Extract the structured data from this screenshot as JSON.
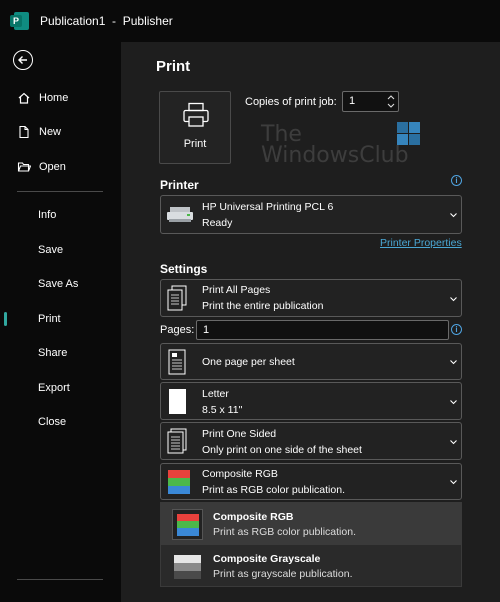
{
  "window": {
    "title": "Publication1  -  Publisher"
  },
  "nav": {
    "items": [
      {
        "label": "Home"
      },
      {
        "label": "New"
      },
      {
        "label": "Open"
      },
      {
        "label": "Info"
      },
      {
        "label": "Save"
      },
      {
        "label": "Save As"
      },
      {
        "label": "Print"
      },
      {
        "label": "Share"
      },
      {
        "label": "Export"
      },
      {
        "label": "Close"
      }
    ],
    "active": "Print"
  },
  "print": {
    "title": "Print",
    "button_label": "Print",
    "copies_label": "Copies of print job:",
    "copies_value": "1"
  },
  "watermark": {
    "line1": "The",
    "line2": "WindowsClub"
  },
  "printer": {
    "heading": "Printer",
    "name": "HP Universal Printing PCL 6",
    "status": "Ready",
    "properties_link": "Printer Properties"
  },
  "settings": {
    "heading": "Settings",
    "print_range": {
      "title": "Print All Pages",
      "desc": "Print the entire publication"
    },
    "pages_label": "Pages:",
    "pages_value": "1",
    "per_sheet": {
      "title": "One page per sheet"
    },
    "paper": {
      "title": "Letter",
      "desc": "8.5 x 11\""
    },
    "sides": {
      "title": "Print One Sided",
      "desc": "Only print on one side of the sheet"
    },
    "color": {
      "title": "Composite RGB",
      "desc": "Print as RGB color publication."
    }
  },
  "color_options": [
    {
      "title": "Composite RGB",
      "desc": "Print as RGB color publication.",
      "selected": true
    },
    {
      "title": "Composite Grayscale",
      "desc": "Print as grayscale publication.",
      "selected": false
    }
  ],
  "colors": {
    "accent": "#31a8a0",
    "link": "#4aa7d4",
    "rgb_red": "#e8413c",
    "rgb_green": "#4cb84a",
    "rgb_blue": "#3a88d6"
  }
}
